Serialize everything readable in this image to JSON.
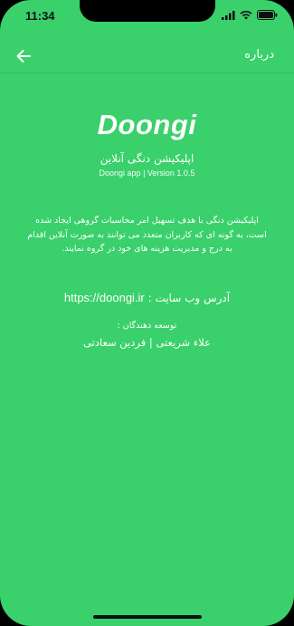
{
  "status_bar": {
    "time": "11:34",
    "icons": [
      "signal-icon",
      "wifi-icon",
      "battery-icon"
    ]
  },
  "app_bar": {
    "title": "درباره",
    "back_icon": "arrow-left-icon"
  },
  "about": {
    "logo_text": "Doongi",
    "subtitle": "اپلیکیشن دنگی آنلاین",
    "version": "Doongi app | Version  1.0.5",
    "description": "اپلیکیشن دنگی با هدف تسهیل امر محاسبات گروهی ایجاد شده است، به گونه ای که کاربران متعدد می توانند  به صورت آنلاین اقدام به درج و مدیریت هزینه های خود در گروه نمایند.",
    "website_label": "آدرس وب سایت : ",
    "website_url": "https://doongi.ir",
    "developers_label": "توسعه دهندگان :",
    "developers": "علاء شریعتی  |  فردین سعادتی"
  },
  "colors": {
    "background": "#3ad06b",
    "text": "#ffffff"
  }
}
